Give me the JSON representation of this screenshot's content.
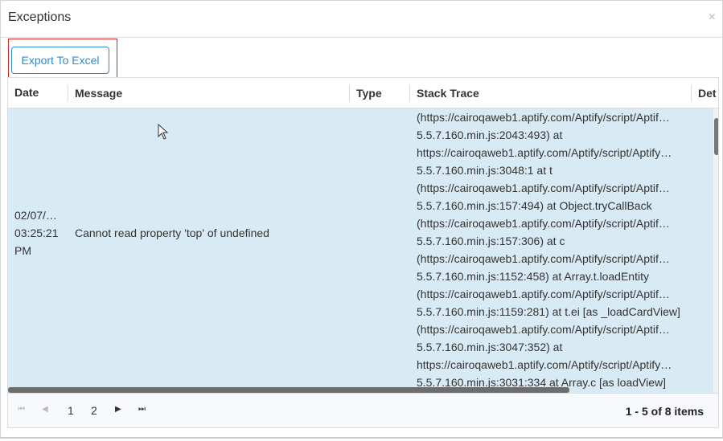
{
  "dialog": {
    "title": "Exceptions",
    "close_icon": "×"
  },
  "toolbar": {
    "export_label": "Export To Excel"
  },
  "grid": {
    "columns": [
      "Date",
      "Message",
      "Type",
      "Stack Trace",
      "Det"
    ],
    "row": {
      "date": [
        "02/07/…",
        "03:25:21",
        "PM"
      ],
      "message": "Cannot read property 'top' of undefined",
      "type": "",
      "stack": [
        "(https://cairoqaweb1.aptify.com/Aptify/script/Aptif…",
        "5.5.7.160.min.js:2043:493) at",
        "https://cairoqaweb1.aptify.com/Aptify/script/Aptify…",
        "5.5.7.160.min.js:3048:1 at t",
        "(https://cairoqaweb1.aptify.com/Aptify/script/Aptif…",
        "5.5.7.160.min.js:157:494) at Object.tryCallBack",
        "(https://cairoqaweb1.aptify.com/Aptify/script/Aptif…",
        "5.5.7.160.min.js:157:306) at c",
        "(https://cairoqaweb1.aptify.com/Aptify/script/Aptif…",
        "5.5.7.160.min.js:1152:458) at Array.t.loadEntity",
        "(https://cairoqaweb1.aptify.com/Aptify/script/Aptif…",
        "5.5.7.160.min.js:1159:281) at t.ei [as _loadCardView]",
        "(https://cairoqaweb1.aptify.com/Aptify/script/Aptif…",
        "5.5.7.160.min.js:3047:352) at",
        "https://cairoqaweb1.aptify.com/Aptify/script/Aptify…",
        "5.5.7.160.min.js:3031:334 at Array.c [as loadView]"
      ]
    }
  },
  "pager": {
    "first": "⏮",
    "prev": "◀",
    "pages": [
      "1",
      "2"
    ],
    "next": "▶",
    "last": "⏭",
    "info": "1 - 5 of 8 items"
  },
  "colors": {
    "accent": "#2b8ccf",
    "selected_row": "#d8eaf4",
    "highlight_box": "#e02020"
  }
}
